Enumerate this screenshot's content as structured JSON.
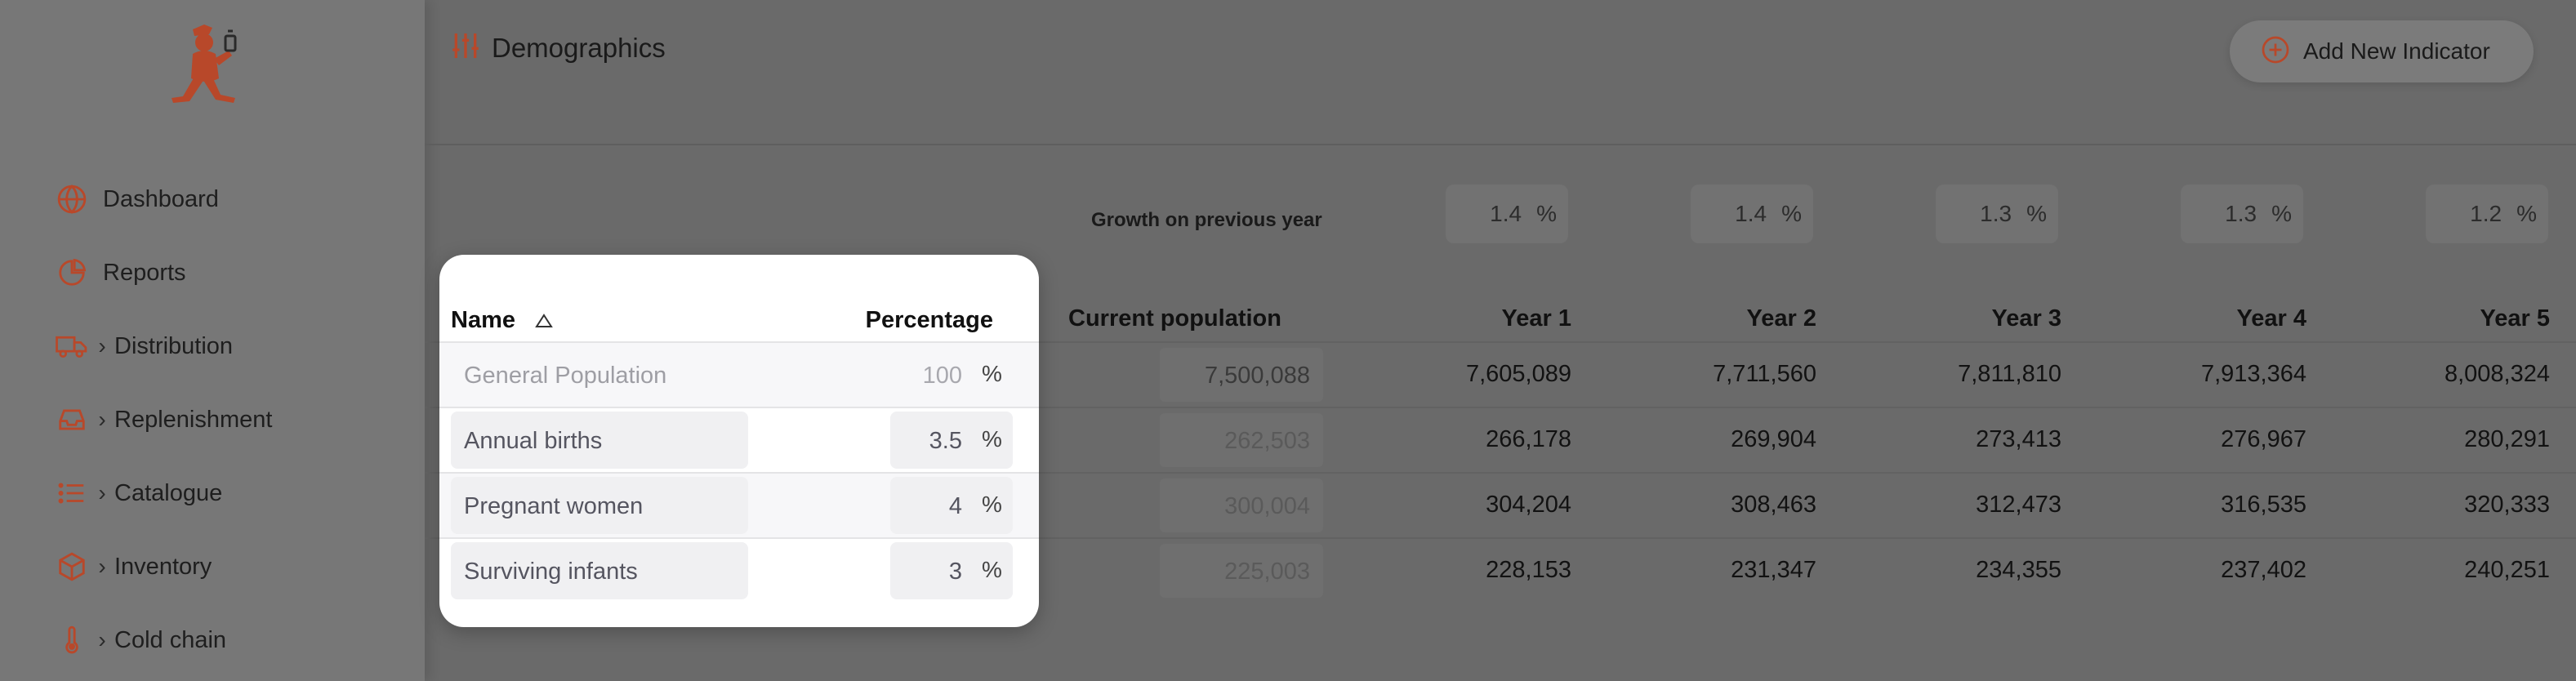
{
  "sidebar": {
    "items": [
      {
        "label": "Dashboard",
        "icon": "globe-icon",
        "chevron": false
      },
      {
        "label": "Reports",
        "icon": "pie-chart-icon",
        "chevron": false
      },
      {
        "label": "Distribution",
        "icon": "truck-icon",
        "chevron": true
      },
      {
        "label": "Replenishment",
        "icon": "inbox-tray-icon",
        "chevron": true
      },
      {
        "label": "Catalogue",
        "icon": "list-icon",
        "chevron": true
      },
      {
        "label": "Inventory",
        "icon": "box-icon",
        "chevron": true
      },
      {
        "label": "Cold chain",
        "icon": "thermometer-icon",
        "chevron": true
      }
    ]
  },
  "header": {
    "title": "Demographics",
    "add_button": "Add New Indicator"
  },
  "growth": {
    "label": "Growth on previous year",
    "values": [
      "1.4",
      "1.4",
      "1.3",
      "1.3",
      "1.2"
    ],
    "unit": "%"
  },
  "table": {
    "headers": {
      "name": "Name",
      "percentage": "Percentage",
      "current": "Current population",
      "years": [
        "Year 1",
        "Year 2",
        "Year 3",
        "Year 4",
        "Year 5"
      ]
    },
    "rows": [
      {
        "name": "General Population",
        "percentage": "100",
        "unit": "%",
        "current": "7,500,088",
        "years": [
          "7,605,089",
          "7,711,560",
          "7,811,810",
          "7,913,364",
          "8,008,324"
        ]
      },
      {
        "name": "Annual births",
        "percentage": "3.5",
        "unit": "%",
        "current": "262,503",
        "years": [
          "266,178",
          "269,904",
          "273,413",
          "276,967",
          "280,291"
        ]
      },
      {
        "name": "Pregnant women",
        "percentage": "4",
        "unit": "%",
        "current": "300,004",
        "years": [
          "304,204",
          "308,463",
          "312,473",
          "316,535",
          "320,333"
        ]
      },
      {
        "name": "Surviving infants",
        "percentage": "3",
        "unit": "%",
        "current": "225,003",
        "years": [
          "228,153",
          "231,347",
          "234,355",
          "237,402",
          "240,251"
        ]
      }
    ]
  },
  "colors": {
    "accent": "#c0512f",
    "overlay": "#6a6a6a",
    "card": "#ffffff"
  }
}
